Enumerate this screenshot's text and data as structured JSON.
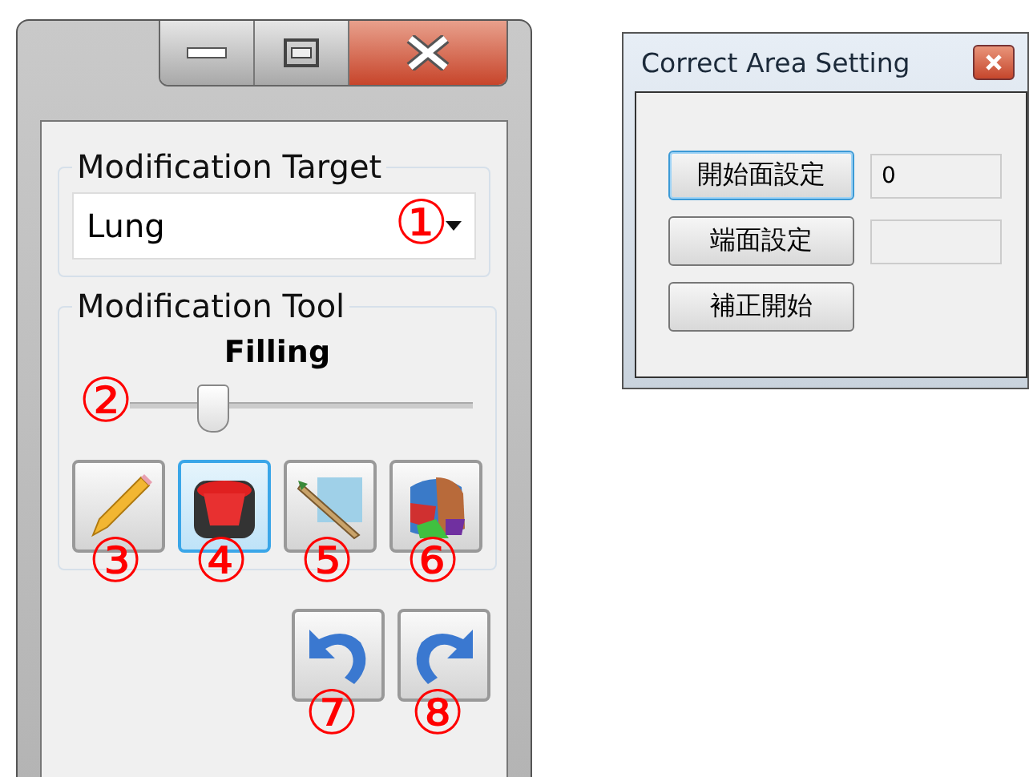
{
  "modification_window": {
    "target_group": {
      "label": "Modification Target",
      "dropdown": {
        "value": "Lung",
        "callout": "①"
      }
    },
    "tool_group": {
      "label": "Modification Tool",
      "tool_name": "Filling",
      "slider": {
        "level": 0.24,
        "callout": "②"
      },
      "tools": [
        {
          "kind": "pencil",
          "selected": false,
          "callout": "③"
        },
        {
          "kind": "fill",
          "selected": true,
          "callout": "④"
        },
        {
          "kind": "brush",
          "selected": false,
          "callout": "⑤"
        },
        {
          "kind": "palette",
          "selected": false,
          "callout": "⑥"
        }
      ]
    },
    "history_buttons": [
      {
        "kind": "undo",
        "callout": "⑦"
      },
      {
        "kind": "redo",
        "callout": "⑧"
      }
    ]
  },
  "correct_area_window": {
    "title": "Correct Area Setting",
    "rows": [
      {
        "button": "開始面設定",
        "focused": true,
        "field": "0"
      },
      {
        "button": "端面設定",
        "focused": false,
        "field": ""
      },
      {
        "button": "補正開始",
        "focused": false
      }
    ]
  }
}
